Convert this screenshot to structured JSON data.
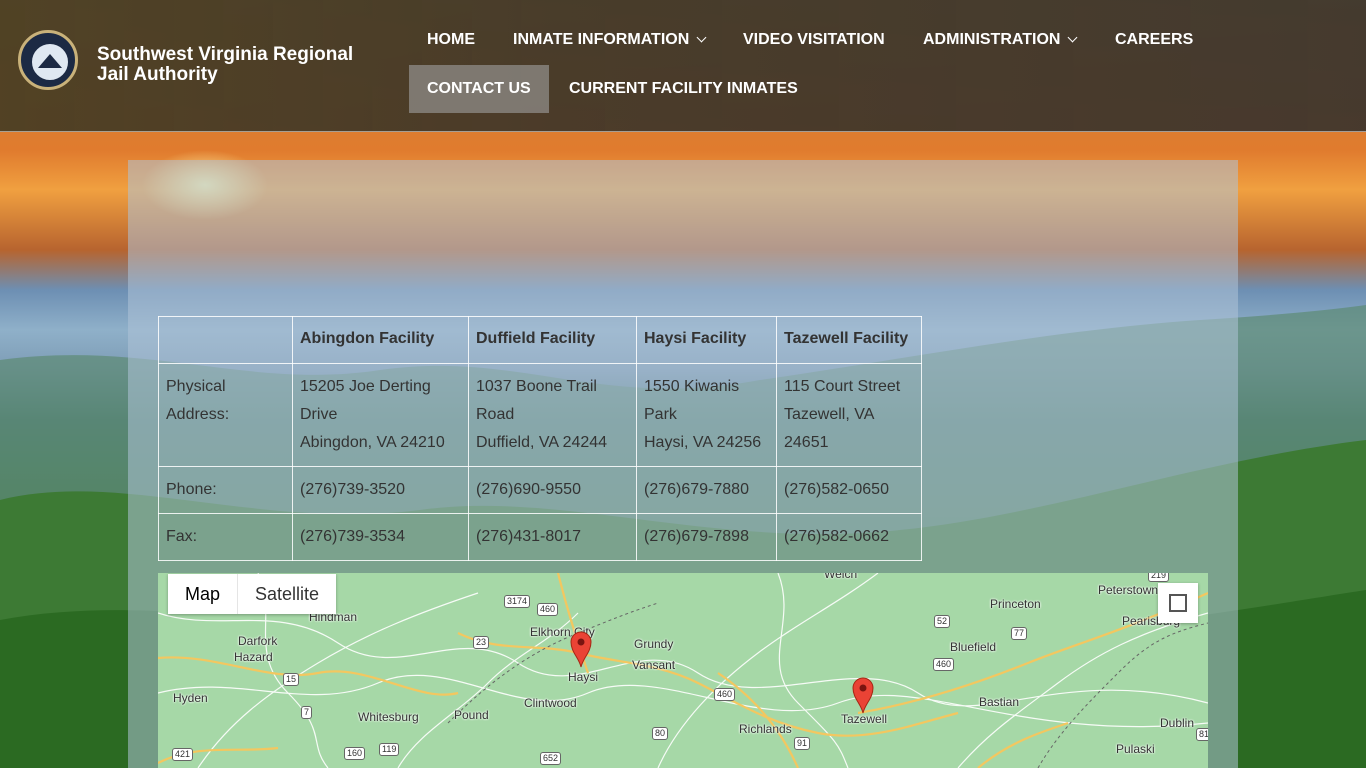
{
  "site": {
    "title": "Southwest Virginia Regional Jail Authority",
    "logo_alt": "Southwest Virginia Regional Jail Authority seal"
  },
  "nav": {
    "items": [
      {
        "label": "HOME"
      },
      {
        "label": "INMATE INFORMATION",
        "has_dropdown": true
      },
      {
        "label": "VIDEO VISITATION"
      },
      {
        "label": "ADMINISTRATION",
        "has_dropdown": true
      },
      {
        "label": "CAREERS"
      },
      {
        "label": "CONTACT US",
        "active": true
      },
      {
        "label": "CURRENT FACILITY INMATES"
      }
    ]
  },
  "facilities_table": {
    "headers": [
      "",
      "Abingdon Facility",
      "Duffield Facility",
      "Haysi Facility",
      "Tazewell Facility"
    ],
    "rows": [
      {
        "label": "Physical Address:",
        "cells": [
          [
            "15205 Joe Derting Drive",
            "Abingdon, VA 24210"
          ],
          [
            "1037 Boone Trail Road",
            "Duffield, VA 24244"
          ],
          [
            "1550 Kiwanis Park",
            "Haysi, VA 24256"
          ],
          [
            "115 Court Street",
            "Tazewell, VA 24651"
          ]
        ]
      },
      {
        "label": "Phone:",
        "cells": [
          "(276)739-3520",
          "(276)690-9550",
          "(276)679-7880",
          "(276)582-0650"
        ]
      },
      {
        "label": "Fax:",
        "cells": [
          "(276)739-3534",
          "(276)431-8017",
          "(276)679-7898",
          "(276)582-0662"
        ]
      }
    ]
  },
  "map": {
    "type_buttons": [
      "Map",
      "Satellite"
    ],
    "selected_type": "Map",
    "places": [
      "Welch",
      "Peterstown",
      "Princeton",
      "Pearisburg",
      "Bluefield",
      "Hindman",
      "Elkhorn City",
      "Grundy",
      "Darfork",
      "Hazard",
      "Vansant",
      "Haysi",
      "Hyden",
      "Whitesburg",
      "Pound",
      "Clintwood",
      "Richlands",
      "Tazewell",
      "Bastian",
      "Dublin",
      "Pulaski"
    ],
    "route_shields": [
      "3174",
      "460",
      "23",
      "15",
      "7",
      "421",
      "160",
      "119",
      "80",
      "652",
      "460",
      "91",
      "52",
      "77",
      "460",
      "219",
      "81"
    ],
    "markers": [
      "Haysi",
      "Tazewell"
    ]
  }
}
